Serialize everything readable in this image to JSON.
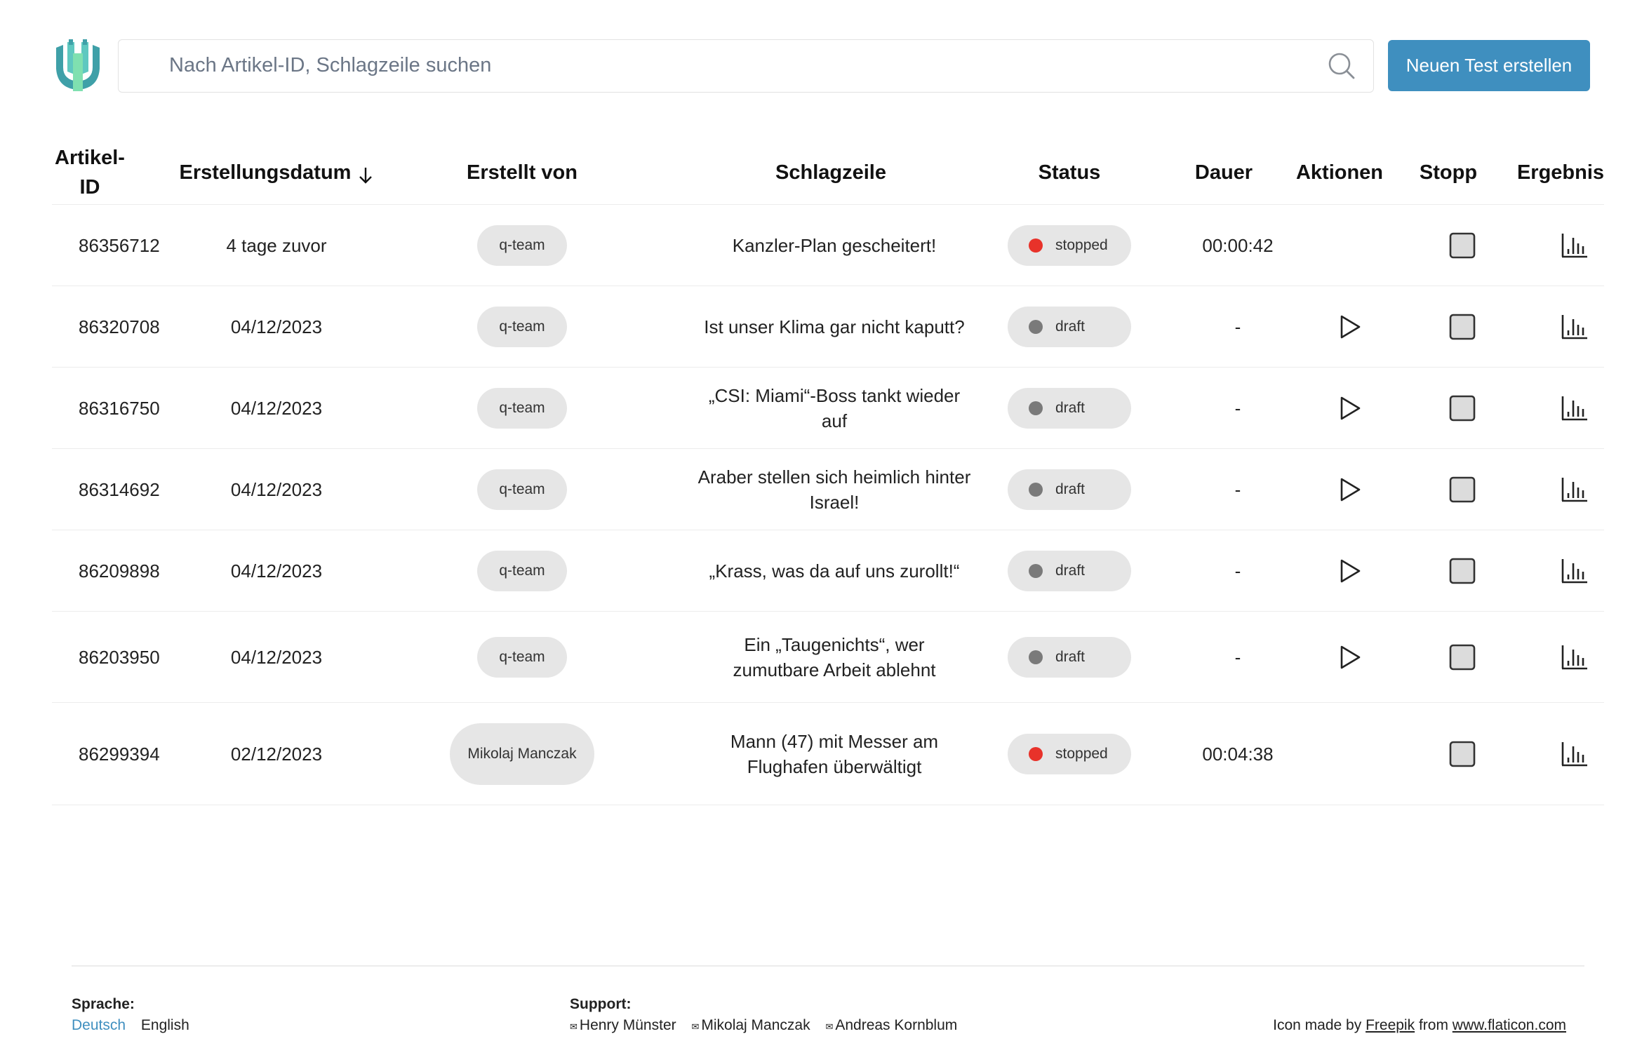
{
  "search": {
    "placeholder": "Nach Artikel-ID, Schlagzeile suchen"
  },
  "header": {
    "new_test_label": "Neuen Test erstellen",
    "logo_icon": "shield-u-logo-icon",
    "search_icon": "magnifier-icon"
  },
  "colors": {
    "accent": "#3f8fbf",
    "stopped": "#e8322a",
    "draft": "#7a7a7a",
    "pill_bg": "#e6e6e6"
  },
  "table": {
    "columns": {
      "id": "Artikel-ID",
      "date": "Erstellungsdatum",
      "creator": "Erstellt von",
      "headline": "Schlagzeile",
      "status": "Status",
      "duration": "Dauer",
      "actions": "Aktionen",
      "stop": "Stopp",
      "result": "Ergebnis"
    },
    "sort_indicator": "arrow-down-icon",
    "rows": [
      {
        "id": "86356712",
        "date": "4 tage zuvor",
        "creator": "q-team",
        "headline": "Kanzler-Plan gescheitert!",
        "status": "stopped",
        "duration": "00:00:42",
        "has_play": false
      },
      {
        "id": "86320708",
        "date": "04/12/2023",
        "creator": "q-team",
        "headline": "Ist unser Klima gar nicht kaputt?",
        "status": "draft",
        "duration": "-",
        "has_play": true
      },
      {
        "id": "86316750",
        "date": "04/12/2023",
        "creator": "q-team",
        "headline": "„CSI: Miami“-Boss tankt wieder auf",
        "status": "draft",
        "duration": "-",
        "has_play": true
      },
      {
        "id": "86314692",
        "date": "04/12/2023",
        "creator": "q-team",
        "headline": "Araber stellen sich heimlich hinter Israel!",
        "status": "draft",
        "duration": "-",
        "has_play": true
      },
      {
        "id": "86209898",
        "date": "04/12/2023",
        "creator": "q-team",
        "headline": "„Krass, was da auf uns zurollt!“",
        "status": "draft",
        "duration": "-",
        "has_play": true
      },
      {
        "id": "86203950",
        "date": "04/12/2023",
        "creator": "q-team",
        "headline": "Ein „Taugenichts“, wer zumutbare Arbeit ablehnt",
        "status": "draft",
        "duration": "-",
        "has_play": true
      },
      {
        "id": "86299394",
        "date": "02/12/2023",
        "creator": "Mikolaj Manczak",
        "headline": "Mann (47) mit Messer am Flughafen überwältigt",
        "status": "stopped",
        "duration": "00:04:38",
        "has_play": false
      }
    ]
  },
  "footer": {
    "language_label": "Sprache:",
    "languages": [
      "Deutsch",
      "English"
    ],
    "support_label": "Support:",
    "support_contacts": [
      "Henry Münster",
      "Mikolaj Manczak",
      "Andreas Kornblum"
    ],
    "credit_prefix": "Icon made by",
    "credit_author": "Freepik",
    "credit_middle": "from",
    "credit_site": "www.flaticon.com"
  }
}
